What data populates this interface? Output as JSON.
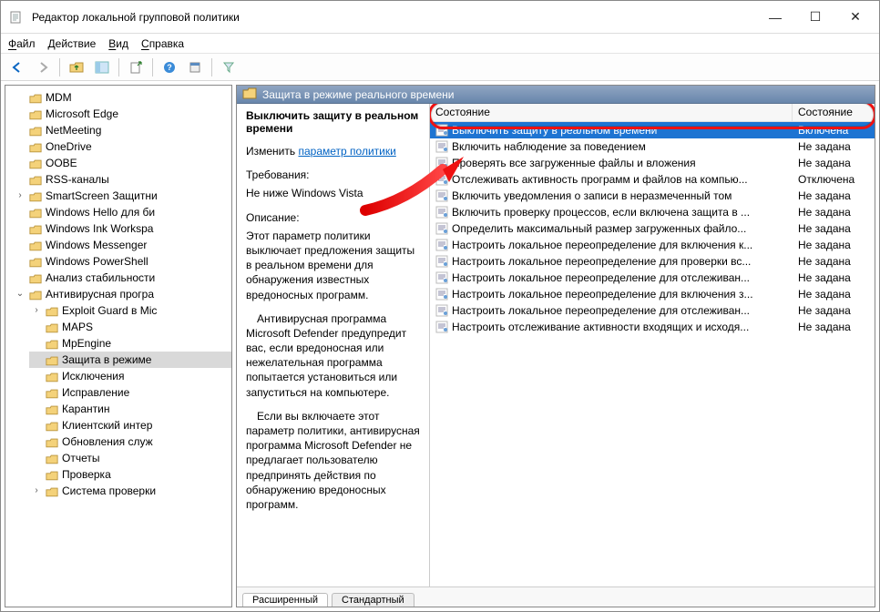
{
  "window": {
    "title": "Редактор локальной групповой политики",
    "min": "—",
    "max": "☐",
    "close": "✕"
  },
  "menubar": {
    "items": [
      "Файл",
      "Действие",
      "Вид",
      "Справка"
    ]
  },
  "right": {
    "header": "Защита в режиме реального времени"
  },
  "detail": {
    "setting_title": "Выключить защиту в реальном времени",
    "edit_label": "Изменить",
    "edit_link": "параметр политики",
    "req_label": "Требования:",
    "req_text": "Не ниже Windows Vista",
    "desc_label": "Описание:",
    "desc_p1": "Этот параметр политики выключает предложения защиты в реальном времени для обнаружения известных вредоносных программ.",
    "desc_p2": "Антивирусная программа Microsoft Defender предупредит вас, если вредоносная или нежелательная программа попытается установиться или запуститься на компьютере.",
    "desc_p3": "Если вы включаете этот параметр политики, антивирусная программа Microsoft Defender не предлагает пользователю предпринять действия по обнаружению вредоносных программ."
  },
  "columns": {
    "name": "Состояние",
    "state": "Состояние"
  },
  "settings": [
    {
      "name": "Выключить защиту в реальном времени",
      "state": "Включена",
      "selected": true
    },
    {
      "name": "Включить наблюдение за поведением",
      "state": "Не задана"
    },
    {
      "name": "Проверять все загруженные файлы и вложения",
      "state": "Не задана"
    },
    {
      "name": "Отслеживать активность программ и файлов на компью...",
      "state": "Отключена"
    },
    {
      "name": "Включить уведомления о записи в неразмеченный том",
      "state": "Не задана"
    },
    {
      "name": "Включить проверку процессов, если включена защита в ...",
      "state": "Не задана"
    },
    {
      "name": "Определить максимальный размер загруженных файло...",
      "state": "Не задана"
    },
    {
      "name": "Настроить локальное переопределение для включения к...",
      "state": "Не задана"
    },
    {
      "name": "Настроить локальное переопределение для проверки вс...",
      "state": "Не задана"
    },
    {
      "name": "Настроить локальное переопределение для отслеживан...",
      "state": "Не задана"
    },
    {
      "name": "Настроить локальное переопределение для включения з...",
      "state": "Не задана"
    },
    {
      "name": "Настроить локальное переопределение для отслеживан...",
      "state": "Не задана"
    },
    {
      "name": "Настроить отслеживание активности входящих и исходя...",
      "state": "Не задана"
    }
  ],
  "tree": [
    {
      "label": "MDM"
    },
    {
      "label": "Microsoft Edge"
    },
    {
      "label": "NetMeeting"
    },
    {
      "label": "OneDrive"
    },
    {
      "label": "OOBE"
    },
    {
      "label": "RSS-каналы"
    },
    {
      "label": "SmartScreen Защитни",
      "expandable": true
    },
    {
      "label": "Windows Hello для би"
    },
    {
      "label": "Windows Ink Workspa"
    },
    {
      "label": "Windows Messenger"
    },
    {
      "label": "Windows PowerShell"
    },
    {
      "label": "Анализ стабильности"
    },
    {
      "label": "Антивирусная програ",
      "expandable": true,
      "expanded": true,
      "children": [
        {
          "label": "Exploit Guard в Miс",
          "expandable": true
        },
        {
          "label": "MAPS"
        },
        {
          "label": "MpEngine"
        },
        {
          "label": "Защита в режиме",
          "selected": true
        },
        {
          "label": "Исключения"
        },
        {
          "label": "Исправление"
        },
        {
          "label": "Карантин"
        },
        {
          "label": "Клиентский интер"
        },
        {
          "label": "Обновления служ"
        },
        {
          "label": "Отчеты"
        },
        {
          "label": "Проверка"
        },
        {
          "label": "Система проверки",
          "expandable": true
        }
      ]
    }
  ],
  "tabs": {
    "extended": "Расширенный",
    "standard": "Стандартный"
  }
}
